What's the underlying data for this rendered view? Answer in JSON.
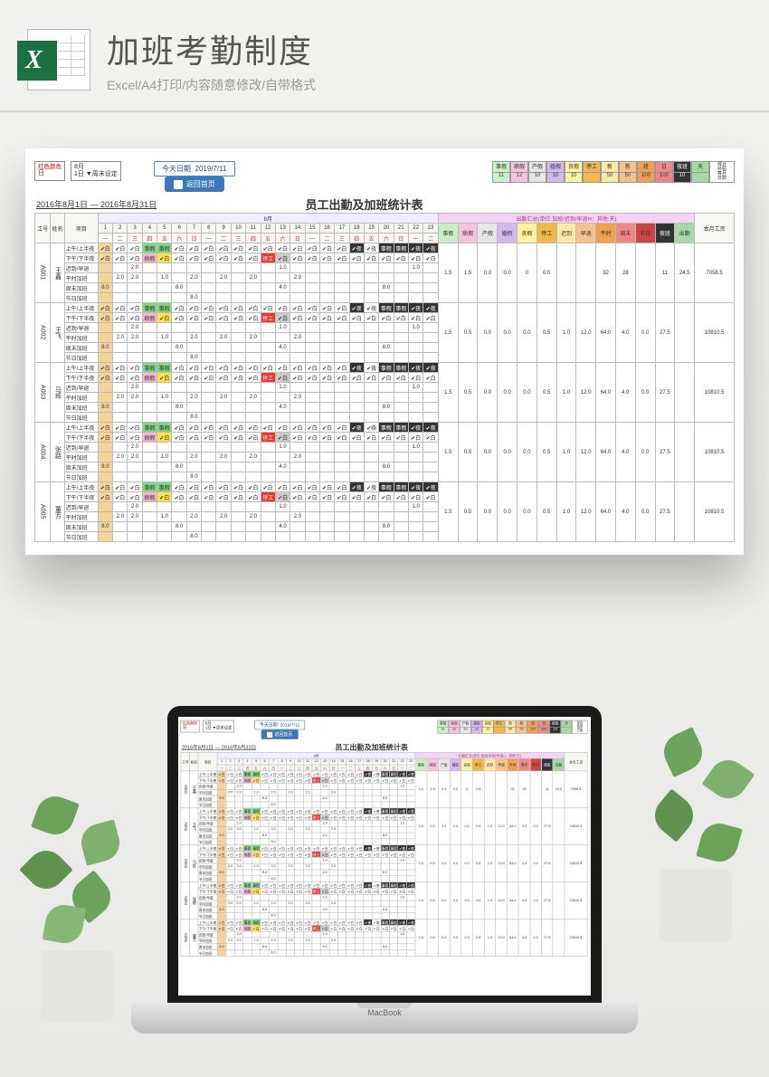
{
  "header": {
    "title": "加班考勤制度",
    "subtitle": "Excel/A4打印/内容随意修改/自带格式"
  },
  "sheet": {
    "today_label": "今天日期",
    "today_value": "2019/7/11",
    "back_button": "返回首页",
    "corner_note_1": "红色颜色",
    "corner_note_2": "日",
    "month_label": "8月",
    "day_label": "1日",
    "weekend_label": "▼周末设定",
    "date_range": "2016年8月1日 — 2016年8月31日",
    "main_title": "员工出勤及加班统计表",
    "month_header": "8月",
    "salary_header": "本月工资",
    "col_headers": {
      "emp_id": "工号",
      "name": "姓名",
      "project": "项目"
    },
    "summary_title": "出勤汇总(单位:加班/迟到/早退H：其他:天)",
    "legend": [
      {
        "h": "事假",
        "v": "11",
        "bg": "#c7f0c7"
      },
      {
        "h": "病假",
        "v": "12",
        "bg": "#f7c1e0"
      },
      {
        "h": "产假",
        "v": "10",
        "bg": "#e6e6e6"
      },
      {
        "h": "婚假",
        "v": "10",
        "bg": "#d4b8f0"
      },
      {
        "h": "丧假",
        "v": "10",
        "bg": "#fff3a0"
      },
      {
        "h": "停工",
        "v": "",
        "bg": "#f0b84d"
      },
      {
        "h": "新",
        "v": "50",
        "bg": "#ffe9a8"
      },
      {
        "h": "新",
        "v": "50",
        "bg": "#f5c28e"
      },
      {
        "h": "班",
        "v": "100",
        "bg": "#f0a050"
      },
      {
        "h": "日",
        "v": "100",
        "bg": "#e88"
      },
      {
        "h": "夜班",
        "v": "10",
        "bg": "#333",
        "fg": "#fff"
      },
      {
        "h": "天",
        "v": "",
        "bg": "#a8d8a8"
      }
    ],
    "summary_cols": [
      "事假",
      "病假",
      "产假",
      "婚假",
      "丧假",
      "停工",
      "迟到",
      "早退",
      "平时",
      "周末",
      "节日",
      "夜班",
      "出勤"
    ],
    "day_numbers": [
      1,
      2,
      3,
      4,
      5,
      6,
      7,
      8,
      9,
      10,
      11,
      12,
      13,
      14,
      15,
      16,
      17,
      18,
      19,
      20,
      21,
      22,
      23
    ],
    "weekdays": [
      "一",
      "二",
      "三",
      "四",
      "五",
      "六",
      "日",
      "一",
      "二",
      "三",
      "四",
      "五",
      "六",
      "日",
      "一",
      "二",
      "三",
      "四",
      "五",
      "六",
      "日",
      "一",
      "二"
    ],
    "row_labels": [
      "上午/上半夜",
      "下午/下半夜",
      "迟到/早退",
      "平时加班",
      "周末加班",
      "节日加班"
    ],
    "employees": [
      {
        "id": "A001",
        "name": "王鑫",
        "salary": "7058.5",
        "summary": [
          "1.5",
          "1.5",
          "0.0",
          "0.0",
          "0",
          "0.5",
          "",
          "",
          "32",
          "28",
          "",
          "11",
          "24.5"
        ]
      },
      {
        "id": "A002",
        "name": "王飞",
        "salary": "10810.5",
        "summary": [
          "1.5",
          "0.5",
          "0.0",
          "0.0",
          "0.0",
          "0.5",
          "1.0",
          "12.0",
          "64.0",
          "4.0",
          "0.0",
          "27.5",
          ""
        ]
      },
      {
        "id": "A003",
        "name": "马辉",
        "salary": "10810.5",
        "summary": [
          "1.5",
          "0.5",
          "0.0",
          "0.0",
          "0.0",
          "0.5",
          "1.0",
          "12.0",
          "64.0",
          "4.0",
          "0.0",
          "27.5",
          ""
        ]
      },
      {
        "id": "A004",
        "name": "张路",
        "salary": "10810.5",
        "summary": [
          "1.5",
          "0.5",
          "0.0",
          "0.0",
          "0.0",
          "0.5",
          "1.0",
          "12.0",
          "64.0",
          "4.0",
          "0.0",
          "27.5",
          ""
        ]
      },
      {
        "id": "A005",
        "name": "董芳",
        "salary": "10810.5",
        "summary": [
          "1.5",
          "0.5",
          "0.0",
          "0.0",
          "0.0",
          "0.5",
          "1.0",
          "12.0",
          "64.0",
          "4.0",
          "0.0",
          "27.5",
          ""
        ]
      }
    ],
    "attendance_pattern": {
      "row1": [
        "✔白",
        "✔白",
        "✔白",
        "事假",
        "事假",
        "✔白",
        "✔白",
        "✔白",
        "✔白",
        "✔白",
        "✔白",
        "✔白",
        "✔白",
        "✔白",
        "✔白",
        "✔白",
        "✔白",
        "✔夜",
        "✔夜",
        "事假",
        "事假",
        "✔夜",
        "✔夜"
      ],
      "row2": [
        "✔白",
        "✔白",
        "✔白",
        "病假",
        "✔白",
        "✔白",
        "✔白",
        "✔白",
        "✔白",
        "✔白",
        "✔白",
        "停工",
        "✔白",
        "✔白",
        "✔白",
        "✔白",
        "✔白",
        "✔白",
        "✔白",
        "✔白",
        "✔白",
        "✔白",
        "✔白"
      ],
      "row3": [
        "",
        "",
        "2.0",
        "",
        "",
        "",
        "",
        "",
        "",
        "",
        "",
        "",
        "1.0",
        "",
        "",
        "",
        "",
        "",
        "",
        "",
        "",
        "1.0",
        ""
      ],
      "row4": [
        "",
        "2.0",
        "2.0",
        "",
        "1.0",
        "",
        "2.0",
        "",
        "2.0",
        "",
        "2.0",
        "",
        "",
        "2.0",
        "",
        "",
        "",
        "",
        "",
        "",
        "",
        "",
        ""
      ],
      "row5": [
        "8.0",
        "",
        "",
        "",
        "",
        "8.0",
        "",
        "",
        "",
        "",
        "",
        "",
        "4.0",
        "",
        "",
        "",
        "",
        "",
        "",
        "8.0",
        "",
        "",
        ""
      ],
      "row6": [
        "",
        "",
        "",
        "",
        "",
        "",
        "8.0",
        "",
        "",
        "",
        "",
        "",
        "",
        "",
        "",
        "",
        "",
        "",
        "",
        "",
        "",
        "",
        ""
      ]
    },
    "cell_styles": {
      "row1": {
        "3": "g",
        "4": "g",
        "19": "bl",
        "20": "bl",
        "17": "bl",
        "21": "bl",
        "22": "bl"
      },
      "row2": {
        "3": "pk",
        "4": "y",
        "11": "r",
        "12": "gr"
      }
    }
  },
  "laptop_label": "MacBook"
}
